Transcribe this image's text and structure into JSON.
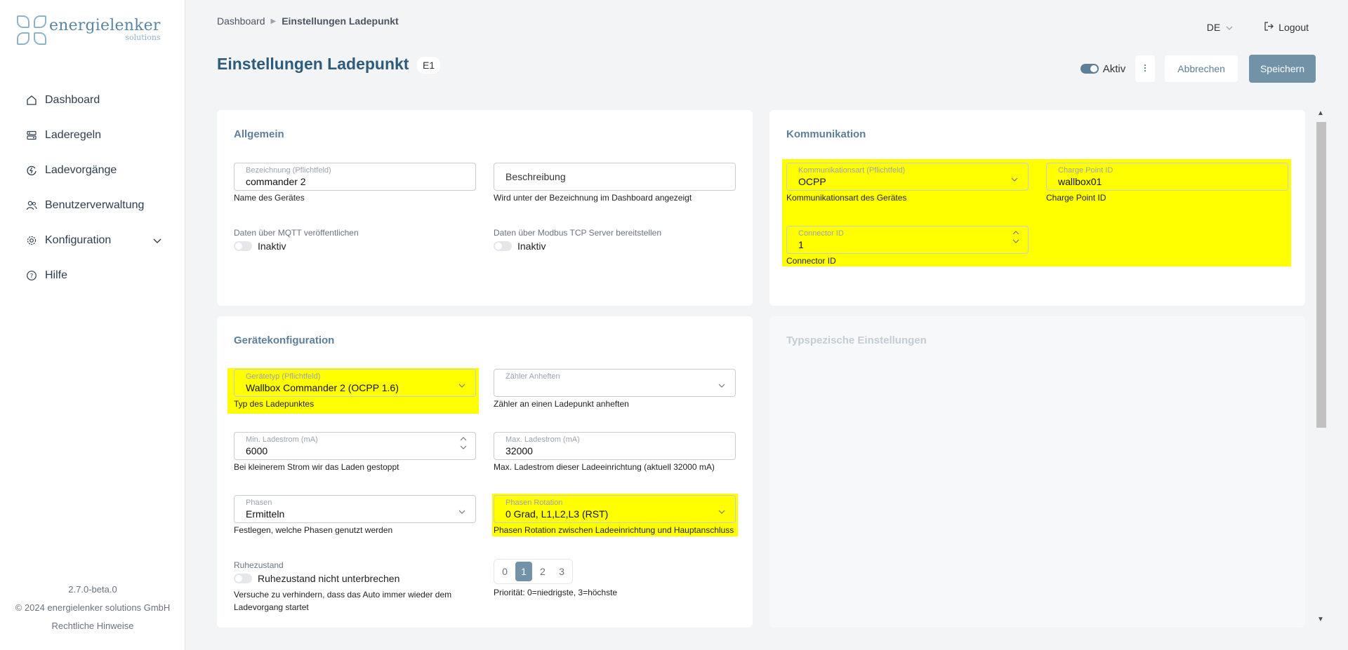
{
  "brand": {
    "name": "energielenker",
    "sub": "solutions"
  },
  "nav": {
    "items": [
      {
        "label": "Dashboard"
      },
      {
        "label": "Laderegeln"
      },
      {
        "label": "Ladevorgänge"
      },
      {
        "label": "Benutzerverwaltung"
      },
      {
        "label": "Konfiguration"
      },
      {
        "label": "Hilfe"
      }
    ]
  },
  "footer": {
    "version": "2.7.0-beta.0",
    "copyright": "© 2024 energielenker solutions GmbH",
    "legal": "Rechtliche Hinweise"
  },
  "breadcrumb": {
    "home": "Dashboard",
    "current": "Einstellungen Ladepunkt"
  },
  "header": {
    "lang": "DE",
    "logout": "Logout"
  },
  "page": {
    "title": "Einstellungen Ladepunkt",
    "badge": "E1"
  },
  "actions": {
    "active_label": "Aktiv",
    "active_on": true,
    "cancel": "Abbrechen",
    "save": "Speichern"
  },
  "allgemein": {
    "title": "Allgemein",
    "bezeichnung_label": "Bezeichnung (Pflichtfeld)",
    "bezeichnung_value": "commander 2",
    "bezeichnung_hint": "Name des Gerätes",
    "beschreibung_placeholder": "Beschreibung",
    "beschreibung_hint": "Wird unter der Bezeichnung im Dashboard angezeigt",
    "mqtt_label": "Daten über MQTT veröffentlichen",
    "mqtt_state": "Inaktiv",
    "modbus_label": "Daten über Modbus TCP Server bereitstellen",
    "modbus_state": "Inaktiv"
  },
  "kommunikation": {
    "title": "Kommunikation",
    "art_label": "Kommunikationsart (Pflichtfeld)",
    "art_value": "OCPP",
    "art_hint": "Kommunikationsart des Gerätes",
    "cpid_label": "Charge Point ID",
    "cpid_value": "wallbox01",
    "cpid_hint": "Charge Point ID",
    "connector_label": "Connector ID",
    "connector_value": "1",
    "connector_hint": "Connector ID"
  },
  "geraet": {
    "title": "Gerätekonfiguration",
    "typ_label": "Gerätetyp (Pflichtfeld)",
    "typ_value": "Wallbox Commander 2 (OCPP 1.6)",
    "typ_hint": "Typ des Ladepunktes",
    "zaehler_label": "Zähler Anheften",
    "zaehler_hint": "Zähler an einen Ladepunkt anheften",
    "min_label": "Min. Ladestrom (mA)",
    "min_value": "6000",
    "min_hint": "Bei kleinerem Strom wir das Laden gestoppt",
    "max_label": "Max. Ladestrom (mA)",
    "max_value": "32000",
    "max_hint": "Max. Ladestrom dieser Ladeeinrichtung (aktuell 32000 mA)",
    "phasen_label": "Phasen",
    "phasen_value": "Ermitteln",
    "phasen_hint": "Festlegen, welche Phasen genutzt werden",
    "rot_label": "Phasen Rotation",
    "rot_value": "0 Grad, L1,L2,L3 (RST)",
    "rot_hint": "Phasen Rotation zwischen Ladeeinrichtung und Hauptanschluss",
    "ruhe_label": "Ruhezustand",
    "ruhe_switch": "Ruhezustand nicht unterbrechen",
    "ruhe_hint_1": "Versuche zu verhindern, dass das Auto immer wieder dem",
    "ruhe_hint_2": "Ladevorgang startet",
    "prio_options": [
      "0",
      "1",
      "2",
      "3"
    ],
    "prio_selected": "1",
    "prio_hint": "Priorität: 0=niedrigste, 3=höchste"
  },
  "typ_spez": {
    "title": "Typspezische Einstellungen"
  },
  "colors": {
    "accent": "#5d7f98",
    "title": "#2e5b7a",
    "highlight": "#ffff00",
    "save_bg": "#7292a8"
  }
}
